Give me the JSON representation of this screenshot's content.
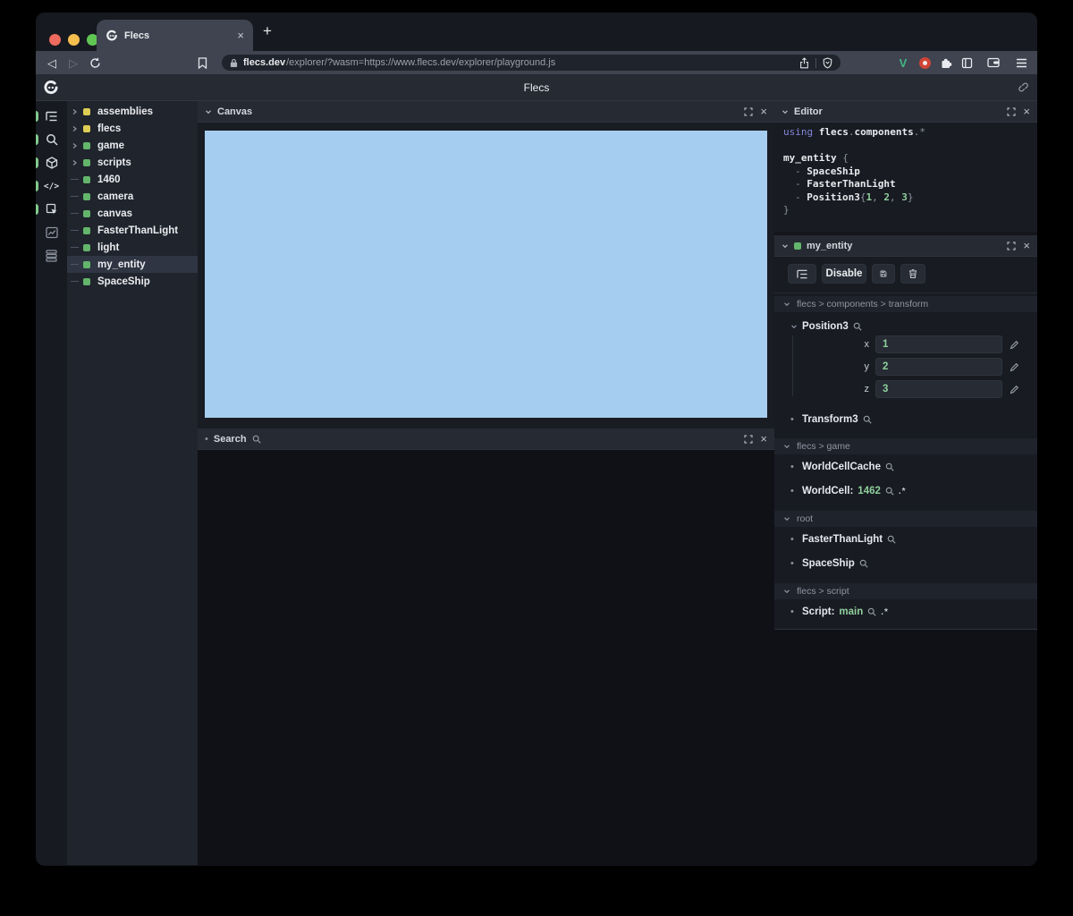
{
  "palette": {
    "accent_green": "#63b56b",
    "accent_yellow": "#ddcd55",
    "value_green": "#8fcf9c",
    "keyword_purple": "#8286d8",
    "canvas_blue": "#a5cdef",
    "selected_row": "#2f3542"
  },
  "icons": {
    "close": "×",
    "new_tab": "+",
    "back": "◁",
    "forward": "▷",
    "bullet": "•",
    "code_tag": "</>",
    "v_extension": "V",
    "pair": ".*"
  },
  "browser": {
    "tab_title": "Flecs",
    "url_domain": "flecs.dev",
    "url_path": "/explorer/?wasm=https://www.flecs.dev/explorer/playground.js"
  },
  "app_header": {
    "title": "Flecs"
  },
  "tree": {
    "items": [
      {
        "label": "assemblies",
        "color": "yellow",
        "kind": "branch",
        "selected": "false"
      },
      {
        "label": "flecs",
        "color": "yellow",
        "kind": "branch",
        "selected": "false"
      },
      {
        "label": "game",
        "color": "green",
        "kind": "branch",
        "selected": "false"
      },
      {
        "label": "scripts",
        "color": "green",
        "kind": "branch",
        "selected": "false"
      },
      {
        "label": "1460",
        "color": "green",
        "kind": "leaf",
        "selected": "false"
      },
      {
        "label": "camera",
        "color": "green",
        "kind": "leaf",
        "selected": "false"
      },
      {
        "label": "canvas",
        "color": "green",
        "kind": "leaf",
        "selected": "false"
      },
      {
        "label": "FasterThanLight",
        "color": "green",
        "kind": "leaf",
        "selected": "false"
      },
      {
        "label": "light",
        "color": "green",
        "kind": "leaf",
        "selected": "false"
      },
      {
        "label": "my_entity",
        "color": "green",
        "kind": "leaf",
        "selected": "true"
      },
      {
        "label": "SpaceShip",
        "color": "green",
        "kind": "leaf",
        "selected": "false"
      }
    ]
  },
  "panels": {
    "canvas": {
      "title": "Canvas"
    },
    "search": {
      "title": "Search"
    },
    "editor": {
      "title": "Editor"
    },
    "inspector": {
      "title": "my_entity"
    }
  },
  "editor_code": {
    "kw_using": "using",
    "ns_flecs": "flecs",
    "dot": ".",
    "ns_components": "components",
    "wildcard": "*",
    "entity_name": "my_entity",
    "brace_open": "{",
    "dash": "-",
    "tag1": "SpaceShip",
    "tag2": "FasterThanLight",
    "comp_name": "Position3",
    "comp_open": "{",
    "num1": "1",
    "comma": ",",
    "num2": "2",
    "num3": "3",
    "comp_close": "}",
    "brace_close": "}"
  },
  "inspector": {
    "disable_label": "Disable",
    "sections": {
      "transform": {
        "path": "flecs > components > transform",
        "position3": {
          "name": "Position3",
          "fields": [
            {
              "label": "x",
              "value": "1"
            },
            {
              "label": "y",
              "value": "2"
            },
            {
              "label": "z",
              "value": "3"
            }
          ]
        },
        "transform3": {
          "name": "Transform3"
        }
      },
      "game": {
        "path": "flecs > game",
        "worldcellcache": {
          "name": "WorldCellCache"
        },
        "worldcell": {
          "name": "WorldCell:",
          "value": "1462",
          "pair": ".*"
        }
      },
      "root": {
        "path": "root",
        "item1": {
          "name": "FasterThanLight"
        },
        "item2": {
          "name": "SpaceShip"
        }
      },
      "script": {
        "path": "flecs > script",
        "script": {
          "name": "Script:",
          "value": "main",
          "pair": ".*"
        }
      }
    }
  }
}
